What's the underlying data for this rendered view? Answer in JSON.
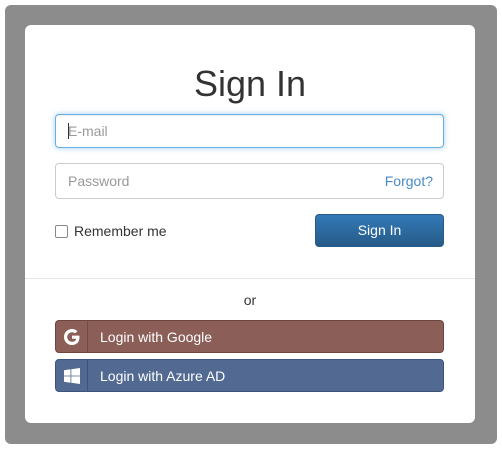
{
  "title": "Sign In",
  "email": {
    "placeholder": "E-mail",
    "value": ""
  },
  "password": {
    "placeholder": "Password",
    "value": ""
  },
  "forgot_label": "Forgot?",
  "remember_label": "Remember me",
  "remember_checked": false,
  "signin_label": "Sign In",
  "or_label": "or",
  "google_label": "Login with Google",
  "azure_label": "Login with Azure AD",
  "colors": {
    "backdrop": "#8c8c8c",
    "primary": "#337ab7",
    "google": "#8b5e58",
    "azure": "#526a92",
    "link": "#4a8ac4"
  },
  "icons": {
    "google": "google-icon",
    "azure": "windows-icon"
  }
}
